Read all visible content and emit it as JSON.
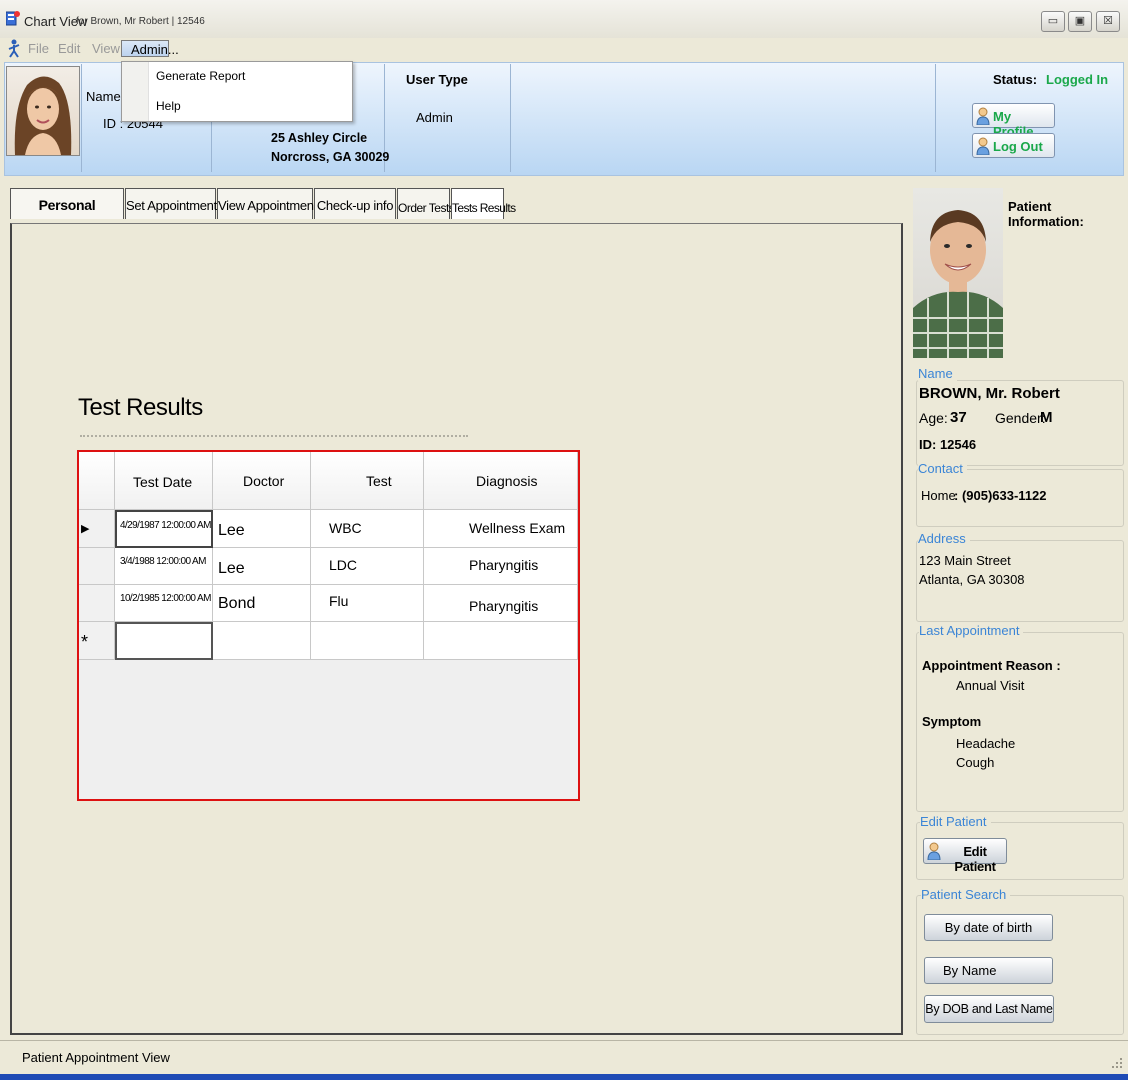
{
  "window": {
    "title": "Chart View",
    "subtitle": "for Brown, Mr Robert | 12546",
    "controls": [
      "▭",
      "▣",
      "☒"
    ]
  },
  "menu": {
    "file": "File",
    "edit": "Edit",
    "view": "View",
    "admin": "Admin...",
    "dropdown": [
      "Generate  Report",
      "Help"
    ]
  },
  "header": {
    "name_label": "Name :",
    "id_label": "ID : 20544",
    "address_line1": "25 Ashley Circle",
    "address_line2": "Norcross, GA 30029",
    "user_type_label": "User Type",
    "user_type_value": "Admin",
    "status_label": "Status:",
    "status_value": "Logged In",
    "my_profile": "My Profile",
    "log_out": "Log Out"
  },
  "tabs": [
    "Personal",
    "Set Appointments",
    "View Appointments",
    "Check-up info",
    "Order Tests",
    "Tests Results"
  ],
  "test_results": {
    "heading": "Test Results",
    "columns": [
      "Test Date",
      "Doctor",
      "Test",
      "Diagnosis"
    ],
    "rows": [
      {
        "date": "4/29/1987 12:00:00 AM",
        "doctor": "Lee",
        "test": "WBC",
        "diagnosis": "Wellness Exam"
      },
      {
        "date": "3/4/1988 12:00:00 AM",
        "doctor": "Lee",
        "test": "LDC",
        "diagnosis": "Pharyngitis"
      },
      {
        "date": "10/2/1985 12:00:00 AM",
        "doctor": "Bond",
        "test": "Flu",
        "diagnosis": "Pharyngitis"
      }
    ],
    "new_row_marker": "*",
    "current_row_marker": "▶"
  },
  "patient": {
    "panel_title": "Patient Information:",
    "name_title": "Name",
    "full_name": "BROWN, Mr. Robert",
    "age_label": "Age:",
    "age_value": "37",
    "gender_label": "Gender:",
    "gender_value": "M",
    "id_label": "ID: 12546",
    "contact_title": "Contact",
    "home_label": "Home",
    "home_value": ": (905)633-1122",
    "address_title": "Address",
    "address_line1": "123 Main Street",
    "address_line2": "Atlanta, GA 30308",
    "last_appt_title": "Last Appointment",
    "reason_label": "Appointment Reason :",
    "reason_value": "Annual Visit",
    "symptom_label": "Symptom",
    "symptoms": [
      "Headache",
      "Cough"
    ],
    "edit_title": "Edit Patient",
    "edit_button": "Edit Patient",
    "search_title": "Patient Search",
    "search_buttons": [
      "By date of birth",
      "By Name",
      "By DOB and Last Name"
    ]
  },
  "status_bar": {
    "text": "Patient Appointment View"
  },
  "colors": {
    "accent_green": "#1aa84a",
    "section_blue": "#3b85d6",
    "highlight_red": "#dd1111",
    "taskbar_blue": "#1f4bb5"
  }
}
